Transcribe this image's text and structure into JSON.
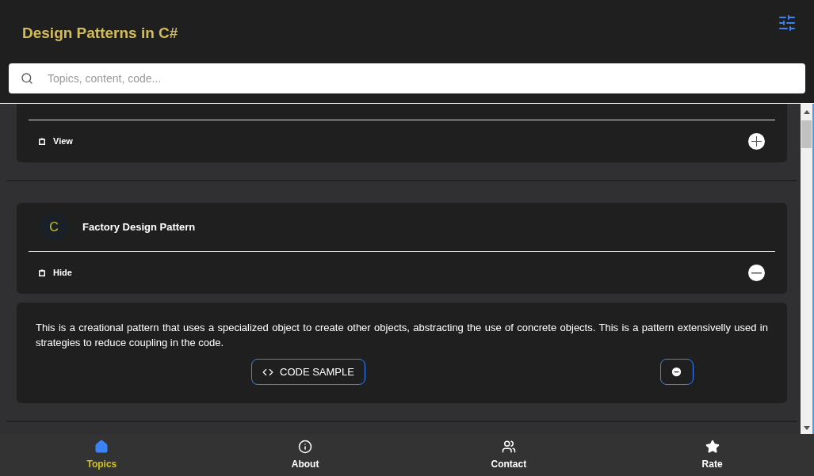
{
  "app_bar": {
    "title": "Design Patterns in C#"
  },
  "search": {
    "placeholder": "Topics, content, code..."
  },
  "patterns": [
    {
      "toggle_label": "View",
      "expanded": false
    },
    {
      "avatar": "C",
      "title": "Factory Design Pattern",
      "toggle_label": "Hide",
      "expanded": true,
      "description": "This is a creational pattern that uses a specialized object to create other objects, abstracting the use of concrete objects. This is a pattern extensivelly used in strategies to reduce coupling in the code.",
      "code_button": "CODE SAMPLE"
    }
  ],
  "bottom_nav": [
    {
      "kind": "home",
      "label": "Topics",
      "selected": true
    },
    {
      "kind": "info",
      "label": "About",
      "selected": false
    },
    {
      "kind": "contact",
      "label": "Contact",
      "selected": false
    },
    {
      "kind": "star",
      "label": "Rate",
      "selected": false
    }
  ]
}
